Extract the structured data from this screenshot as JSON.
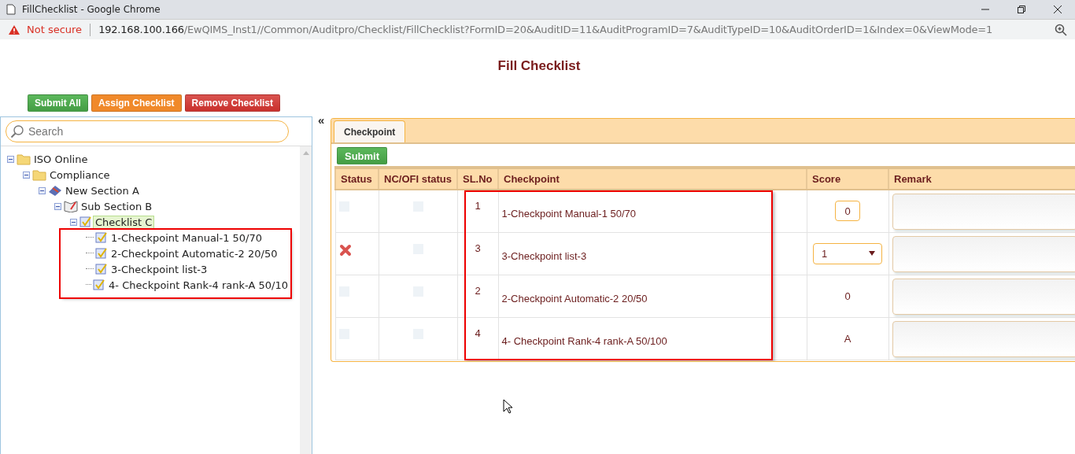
{
  "window": {
    "title": "FillChecklist - Google Chrome"
  },
  "address_bar": {
    "security": "Not secure",
    "host": "192.168.100.166",
    "path": "/EwQIMS_Inst1//Common/Auditpro/Checklist/FillChecklist?FormID=20&AuditID=11&AuditProgramID=7&AuditTypeID=10&AuditOrderID=1&Index=0&ViewMode=1"
  },
  "page_title": "Fill Checklist",
  "actions": [
    {
      "label": "Submit All",
      "kind": "success"
    },
    {
      "label": "Assign Checklist",
      "kind": "warning"
    },
    {
      "label": "Remove Checklist",
      "kind": "danger"
    }
  ],
  "search": {
    "placeholder": "Search"
  },
  "collapse": "«",
  "tree": [
    {
      "label": "ISO Online",
      "kind": "folder",
      "selected": false,
      "expanded": true,
      "children": [
        {
          "label": "Compliance",
          "kind": "folder",
          "selected": false,
          "expanded": true,
          "children": [
            {
              "label": "New Section A",
              "kind": "section",
              "selected": false,
              "expanded": true,
              "children": [
                {
                  "label": "Sub Section B",
                  "kind": "subsection",
                  "selected": false,
                  "expanded": true,
                  "children": [
                    {
                      "label": "Checklist C",
                      "kind": "checklist",
                      "selected": true,
                      "expanded": true,
                      "highlighted": true,
                      "children": [
                        {
                          "label": "1-Checkpoint Manual-1 50/70",
                          "kind": "checkpoint",
                          "selected": false
                        },
                        {
                          "label": "2-Checkpoint Automatic-2 20/50",
                          "kind": "checkpoint",
                          "selected": false
                        },
                        {
                          "label": "3-Checkpoint list-3",
                          "kind": "checkpoint",
                          "selected": false
                        },
                        {
                          "label": "4- Checkpoint Rank-4 rank-A 50/10",
                          "kind": "checkpoint",
                          "selected": false
                        }
                      ]
                    }
                  ]
                }
              ]
            }
          ]
        }
      ]
    }
  ],
  "tabs": [
    {
      "label": "Checkpoint",
      "selected": true
    }
  ],
  "submit": "Submit",
  "table": {
    "columns": [
      "Status",
      "NC/OFI status",
      "SL.No",
      "Checkpoint",
      "Score",
      "Remark"
    ],
    "highlighted": true,
    "rows": [
      {
        "failed": false,
        "sl_no": "1",
        "checkpoint": "1-Checkpoint Manual-1 50/70",
        "score": {
          "kind": "input",
          "value": "0"
        }
      },
      {
        "failed": true,
        "sl_no": "3",
        "checkpoint": "3-Checkpoint list-3",
        "score": {
          "kind": "select",
          "value": "1"
        }
      },
      {
        "failed": false,
        "sl_no": "2",
        "checkpoint": "2-Checkpoint Automatic-2 20/50",
        "score": {
          "kind": "text",
          "value": "0"
        }
      },
      {
        "failed": false,
        "sl_no": "4",
        "checkpoint": "4- Checkpoint Rank-4 rank-A 50/100",
        "score": {
          "kind": "text",
          "value": "A"
        }
      }
    ]
  }
}
